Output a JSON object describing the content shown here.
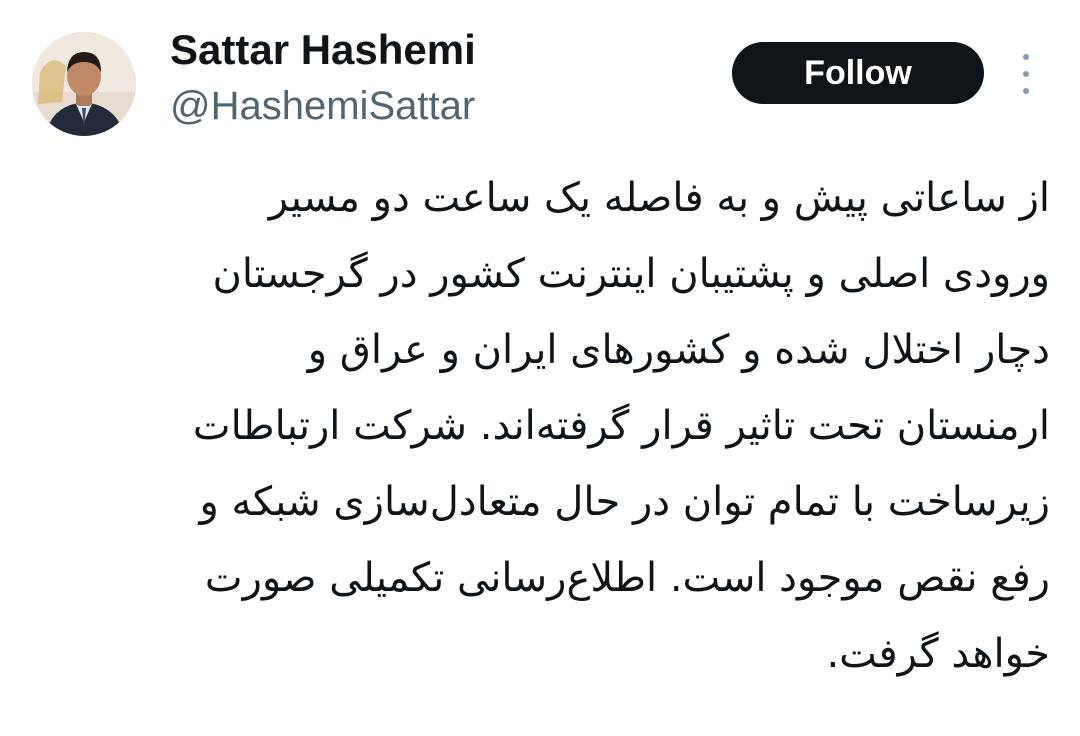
{
  "author": {
    "name": "Sattar Hashemi",
    "handle": "@HashemiSattar",
    "avatar_icon": "profile-photo"
  },
  "actions": {
    "follow_label": "Follow",
    "more_icon": "vertical-ellipsis-icon"
  },
  "tweet": {
    "lines": [
      "از ساعاتی پیش و به فاصله یک ساعت دو مسیر",
      "ورودی اصلی و پشتیبان اینترنت کشور در گرجستان",
      "دچار اختلال شده و کشورهای ایران و عراق و",
      "ارمنستان تحت تاثیر قرار گرفته‌اند. شرکت ارتباطات",
      "زیرساخت با تمام توان در حال متعادل‌سازی شبکه و",
      "رفع نقص موجود است.  اطلاع‌رسانی تکمیلی صورت",
      "خواهد گرفت."
    ]
  },
  "colors": {
    "text_primary": "#0f1419",
    "text_secondary": "#536471",
    "button_bg": "#0f1419",
    "button_text": "#ffffff"
  }
}
